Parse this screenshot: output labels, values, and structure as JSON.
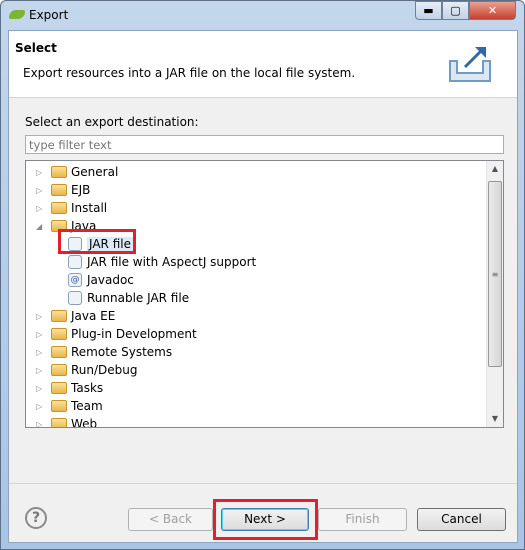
{
  "window": {
    "title": "Export"
  },
  "header": {
    "title": "Select",
    "description": "Export resources into a JAR file on the local file system."
  },
  "main": {
    "label": "Select an export destination:",
    "filter": {
      "placeholder": "type filter text",
      "value": ""
    },
    "tree": [
      {
        "label": "General",
        "type": "folder",
        "level": 0,
        "expanded": false
      },
      {
        "label": "EJB",
        "type": "folder",
        "level": 0,
        "expanded": false
      },
      {
        "label": "Install",
        "type": "folder",
        "level": 0,
        "expanded": false
      },
      {
        "label": "Java",
        "type": "folder",
        "level": 0,
        "expanded": true
      },
      {
        "label": "JAR file",
        "type": "item",
        "level": 1,
        "selected": true
      },
      {
        "label": "JAR file with AspectJ support",
        "type": "item",
        "level": 1
      },
      {
        "label": "Javadoc",
        "type": "item",
        "level": 1
      },
      {
        "label": "Runnable JAR file",
        "type": "item",
        "level": 1
      },
      {
        "label": "Java EE",
        "type": "folder",
        "level": 0,
        "expanded": false
      },
      {
        "label": "Plug-in Development",
        "type": "folder",
        "level": 0,
        "expanded": false
      },
      {
        "label": "Remote Systems",
        "type": "folder",
        "level": 0,
        "expanded": false
      },
      {
        "label": "Run/Debug",
        "type": "folder",
        "level": 0,
        "expanded": false
      },
      {
        "label": "Tasks",
        "type": "folder",
        "level": 0,
        "expanded": false
      },
      {
        "label": "Team",
        "type": "folder",
        "level": 0,
        "expanded": false
      },
      {
        "label": "Web",
        "type": "folder",
        "level": 0,
        "expanded": false
      }
    ]
  },
  "buttons": {
    "back": "< Back",
    "next": "Next >",
    "finish": "Finish",
    "cancel": "Cancel",
    "help": "?"
  },
  "colors": {
    "highlight": "#e0202c",
    "selection": "#dceaf8"
  }
}
